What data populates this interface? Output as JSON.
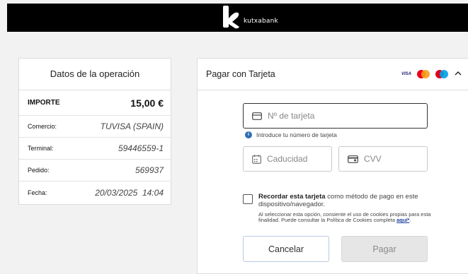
{
  "header": {
    "brand": "kutxabank",
    "logo_icon": "k-logo-icon",
    "background": "#000000"
  },
  "summary": {
    "title": "Datos de la operación",
    "rows": [
      {
        "label": "IMPORTE",
        "value": "15,00 €"
      },
      {
        "label": "Comercio:",
        "value": "TUVISA (SPAIN)"
      },
      {
        "label": "Terminal:",
        "value": "59446559-1"
      },
      {
        "label": "Pedido:",
        "value": "569937"
      },
      {
        "label": "Fecha:",
        "value": "20/03/2025  14:04"
      }
    ]
  },
  "payment": {
    "title": "Pagar con Tarjeta",
    "card_brands": [
      "VISA",
      "mastercard-icon",
      "maestro-icon"
    ],
    "collapse_icon": "chevron-up-icon",
    "card_number_placeholder": "Nº de tarjeta",
    "card_number_hint": "Introduce tu número de tarjeta",
    "expiry_placeholder": "Caducidad",
    "cvv_placeholder": "CVV",
    "remember": {
      "bold": "Recordar esta tarjeta",
      "rest": " como método de pago en este dispositivo/navegador.",
      "consent": "Al seleccionar esta opción, consiente el uso de cookies propias para esta finalidad. Puede consultar la Política de Cookies completa ",
      "link": "aquí*",
      "link_suffix": "."
    },
    "cancel_label": "Cancelar",
    "pay_label": "Pagar"
  },
  "colors": {
    "accent_blue": "#2f6db5",
    "link": "#1a3fa0",
    "disabled_button": "#e6e6e6"
  }
}
